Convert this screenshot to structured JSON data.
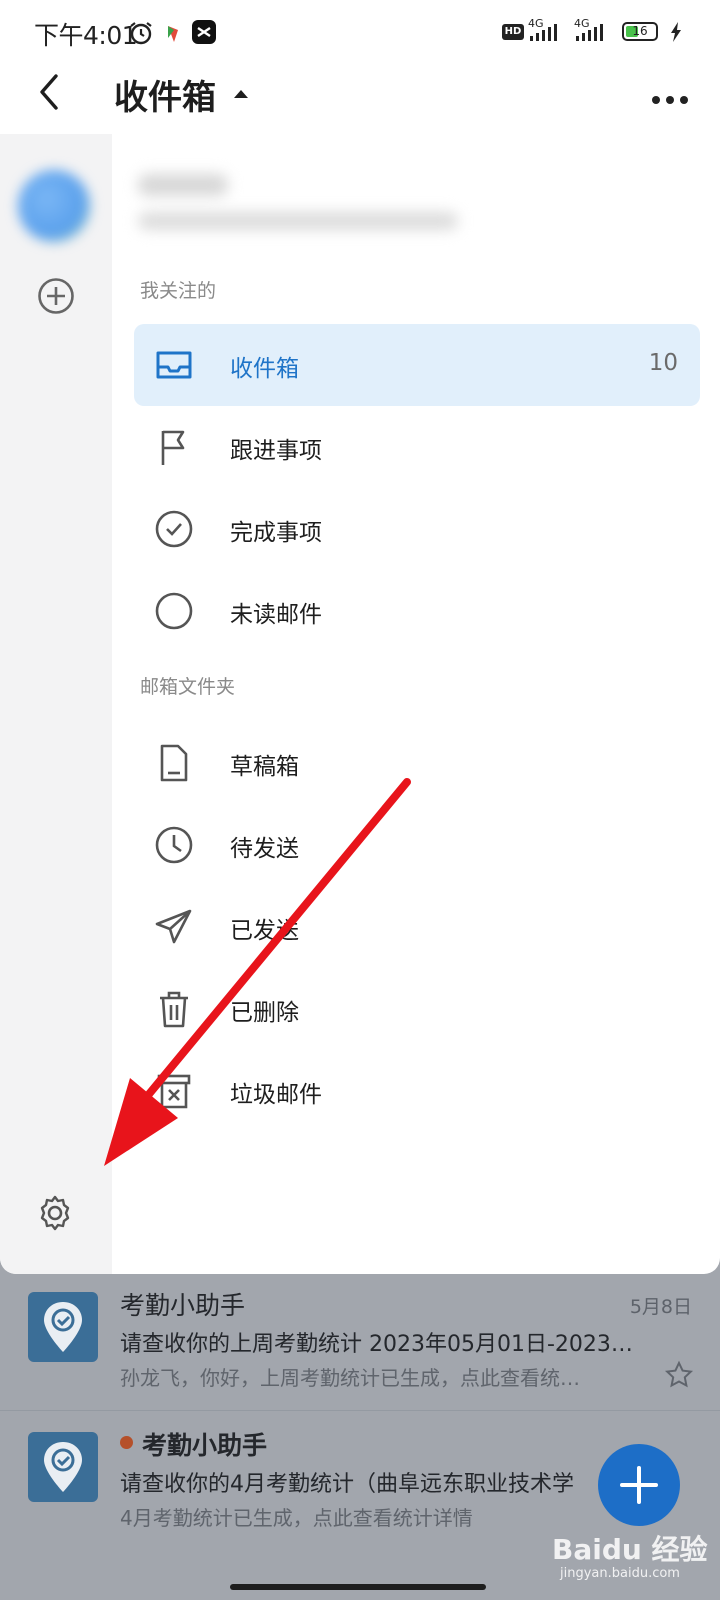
{
  "status_bar": {
    "time": "下午4:01",
    "network_1": "4G",
    "network_2": "4G",
    "battery": "16",
    "icons": [
      "alarm-icon",
      "app-notification-icon",
      "capcut-icon",
      "hd-icon",
      "signal-icon",
      "battery-icon",
      "charging-icon"
    ]
  },
  "header": {
    "title": "收件箱",
    "icons": [
      "back-arrow-icon",
      "caret-up-icon",
      "more-icon"
    ]
  },
  "drawer": {
    "followed_section": "我关注的",
    "followed_items": [
      {
        "label": "收件箱",
        "count": "10",
        "icon": "inbox-icon",
        "active": true
      },
      {
        "label": "跟进事项",
        "icon": "flag-icon"
      },
      {
        "label": "完成事项",
        "icon": "check-circle-icon"
      },
      {
        "label": "未读邮件",
        "icon": "circle-icon"
      }
    ],
    "folders_section": "邮箱文件夹",
    "folder_items": [
      {
        "label": "草稿箱",
        "icon": "draft-icon"
      },
      {
        "label": "待发送",
        "icon": "clock-icon"
      },
      {
        "label": "已发送",
        "icon": "send-icon"
      },
      {
        "label": "已删除",
        "icon": "trash-icon"
      },
      {
        "label": "垃圾邮件",
        "icon": "spam-icon"
      }
    ],
    "rail_icons": [
      "add-account-icon",
      "settings-icon"
    ]
  },
  "emails": [
    {
      "sender": "考勤小助手",
      "date": "5月8日",
      "subject": "请查收你的上周考勤统计 2023年05月01日-2023…",
      "preview": "孙龙飞，你好，上周考勤统计已生成，点此查看统…",
      "unread": false
    },
    {
      "sender": "考勤小助手",
      "date": "",
      "subject": "请查收你的4月考勤统计（曲阜远东职业技术学",
      "preview": "4月考勤统计已生成，点此查看统计详情",
      "unread": true
    }
  ],
  "watermark": {
    "brand": "Baidu 经验",
    "url": "jingyan.baidu.com"
  },
  "colors": {
    "accent": "#1f74c8",
    "active_bg": "#e1effb",
    "fab": "#1d6ec7",
    "annotation_arrow": "#e8141b"
  }
}
